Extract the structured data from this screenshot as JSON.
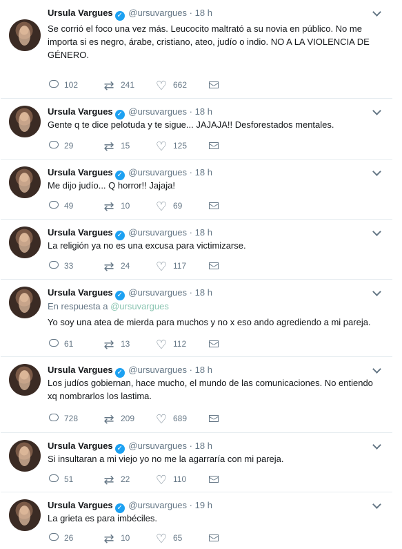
{
  "tweets": [
    {
      "name": "Ursula Vargues",
      "handle": "@ursuvargues",
      "separator": "·",
      "time": "18 h",
      "reply_to_label": "",
      "reply_to_handle": "",
      "text": "Se corrió el foco una vez más. Leucocito maltrató a su novia en público. No me importa si es negro, árabe, cristiano, ateo, judío  o indio. NO A LA VIOLENCIA DE GÉNERO.",
      "replies": "102",
      "retweets": "241",
      "likes": "662"
    },
    {
      "name": "Ursula Vargues",
      "handle": "@ursuvargues",
      "separator": "·",
      "time": "18 h",
      "reply_to_label": "",
      "reply_to_handle": "",
      "text": "Gente q te dice pelotuda y te sigue... JAJAJA!! Desforestados mentales.",
      "replies": "29",
      "retweets": "15",
      "likes": "125"
    },
    {
      "name": "Ursula Vargues",
      "handle": "@ursuvargues",
      "separator": "·",
      "time": "18 h",
      "reply_to_label": "",
      "reply_to_handle": "",
      "text": "Me dijo judío... Q horror!! Jajaja!",
      "replies": "49",
      "retweets": "10",
      "likes": "69"
    },
    {
      "name": "Ursula Vargues",
      "handle": "@ursuvargues",
      "separator": "·",
      "time": "18 h",
      "reply_to_label": "",
      "reply_to_handle": "",
      "text": "La religión ya no es una excusa para victimizarse.",
      "replies": "33",
      "retweets": "24",
      "likes": "117"
    },
    {
      "name": "Ursula Vargues",
      "handle": "@ursuvargues",
      "separator": "·",
      "time": "18 h",
      "reply_to_label": "En respuesta a",
      "reply_to_handle": "@ursuvargues",
      "text": "Yo soy una atea de mierda para muchos y no x eso ando agrediendo a mi pareja.",
      "replies": "61",
      "retweets": "13",
      "likes": "112"
    },
    {
      "name": "Ursula Vargues",
      "handle": "@ursuvargues",
      "separator": "·",
      "time": "18 h",
      "reply_to_label": "",
      "reply_to_handle": "",
      "text": "Los judíos gobiernan, hace mucho, el mundo de las comunicaciones. No entiendo xq nombrarlos los lastima.",
      "replies": "728",
      "retweets": "209",
      "likes": "689"
    },
    {
      "name": "Ursula Vargues",
      "handle": "@ursuvargues",
      "separator": "·",
      "time": "18 h",
      "reply_to_label": "",
      "reply_to_handle": "",
      "text": "Si insultaran a mi viejo yo no me la agarraría con mi pareja.",
      "replies": "51",
      "retweets": "22",
      "likes": "110"
    },
    {
      "name": "Ursula Vargues",
      "handle": "@ursuvargues",
      "separator": "·",
      "time": "19 h",
      "reply_to_label": "",
      "reply_to_handle": "",
      "text": "La grieta es para imbéciles.",
      "replies": "26",
      "retweets": "10",
      "likes": "65"
    }
  ],
  "icons": {
    "verified": "verified-badge-icon",
    "menu": "chevron-down-icon",
    "reply": "reply-bubble-icon",
    "retweet": "retweet-icon",
    "like": "heart-icon",
    "dm": "envelope-icon"
  },
  "colors": {
    "verified": "#1da1f2",
    "muted": "#657786",
    "reply_handle": "#8bc5b2",
    "divider": "#e6ecf0"
  }
}
